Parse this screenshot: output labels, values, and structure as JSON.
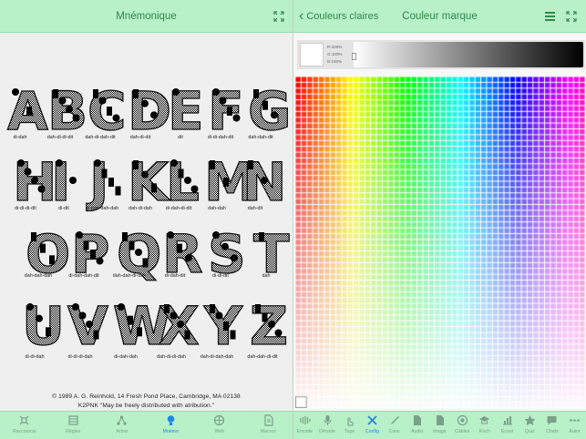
{
  "left_panel": {
    "nav_title": "Mnémonique",
    "letters": [
      {
        "letter": "A",
        "code": "di-dah"
      },
      {
        "letter": "B",
        "code": "dah-di-di-dit"
      },
      {
        "letter": "C",
        "code": "dah-di-dah-dit"
      },
      {
        "letter": "D",
        "code": "dah-di-dit"
      },
      {
        "letter": "E",
        "code": "dit"
      },
      {
        "letter": "F",
        "code": "di-di-dah-dit"
      },
      {
        "letter": "G",
        "code": "dah-dah-dit"
      },
      {
        "letter": "H",
        "code": "di-di-di-dit"
      },
      {
        "letter": "I",
        "code": "di-dit"
      },
      {
        "letter": "J",
        "code": "di-dah-dah-dah"
      },
      {
        "letter": "K",
        "code": "dah-di-dah"
      },
      {
        "letter": "L",
        "code": "di-dah-di-dit"
      },
      {
        "letter": "M",
        "code": "dah-dah"
      },
      {
        "letter": "N",
        "code": "dah-dit"
      },
      {
        "letter": "O",
        "code": "dah-dah-dah"
      },
      {
        "letter": "P",
        "code": "di-dah-dah-dit"
      },
      {
        "letter": "Q",
        "code": "dah-dah-di-dah"
      },
      {
        "letter": "R",
        "code": "di-dah-dit"
      },
      {
        "letter": "S",
        "code": "di-di-dit"
      },
      {
        "letter": "T",
        "code": "dah"
      },
      {
        "letter": "U",
        "code": "di-di-dah"
      },
      {
        "letter": "V",
        "code": "di-di-di-dah"
      },
      {
        "letter": "W",
        "code": "di-dah-dah"
      },
      {
        "letter": "X",
        "code": "dah-di-di-dah"
      },
      {
        "letter": "Y",
        "code": "dah-di-dah-dah"
      },
      {
        "letter": "Z",
        "code": "dah-dah-di-dit"
      }
    ],
    "copyright_line1": "© 1989 A. G. Reinhold, 14 Fresh Pond Place, Cambridge, MA 02138",
    "copyright_line2": "K2PNK  \"May be freely distributed with atribution.\"",
    "tabs": [
      {
        "label": "Raccourcis",
        "icon": "shortcut-icon",
        "active": false
      },
      {
        "label": "Règles",
        "icon": "rules-icon",
        "active": false
      },
      {
        "label": "Arbre",
        "icon": "tree-icon",
        "active": false
      },
      {
        "label": "Mnémo",
        "icon": "lightbulb-icon",
        "active": true
      },
      {
        "label": "Web",
        "icon": "globe-icon",
        "active": false
      },
      {
        "label": "Macros",
        "icon": "document-icon",
        "active": false
      }
    ]
  },
  "right_panel": {
    "back_label": "Couleurs claires",
    "nav_title": "Couleur marque",
    "rgb": {
      "r": "R:100%",
      "g": "G:100%",
      "b": "B:100%"
    },
    "tabs": [
      {
        "label": "Encode",
        "icon": "encode-icon",
        "active": false
      },
      {
        "label": "Décode",
        "icon": "microphone-icon",
        "active": false
      },
      {
        "label": "Tape",
        "icon": "tap-icon",
        "active": false
      },
      {
        "label": "Config",
        "icon": "tools-icon",
        "active": true
      },
      {
        "label": "Conv.",
        "icon": "pencil-icon",
        "active": false
      },
      {
        "label": "Audio",
        "icon": "audio-file-icon",
        "active": false
      },
      {
        "label": "Image",
        "icon": "image-file-icon",
        "active": false
      },
      {
        "label": "Câbles",
        "icon": "cable-icon",
        "active": false
      },
      {
        "label": "Koch",
        "icon": "graduation-cap-icon",
        "active": false
      },
      {
        "label": "Ecout",
        "icon": "bar-chart-icon",
        "active": false
      },
      {
        "label": "Quiz",
        "icon": "quiz-icon",
        "active": false
      },
      {
        "label": "Chats",
        "icon": "chat-icon",
        "active": false
      },
      {
        "label": "Autre",
        "icon": "more-icon",
        "active": false
      }
    ]
  },
  "colors": {
    "nav_bg": "#b8f0c8",
    "nav_text": "#2f8a4a",
    "active_tab": "#1e88e5",
    "inactive_tab": "#7aa08a"
  }
}
